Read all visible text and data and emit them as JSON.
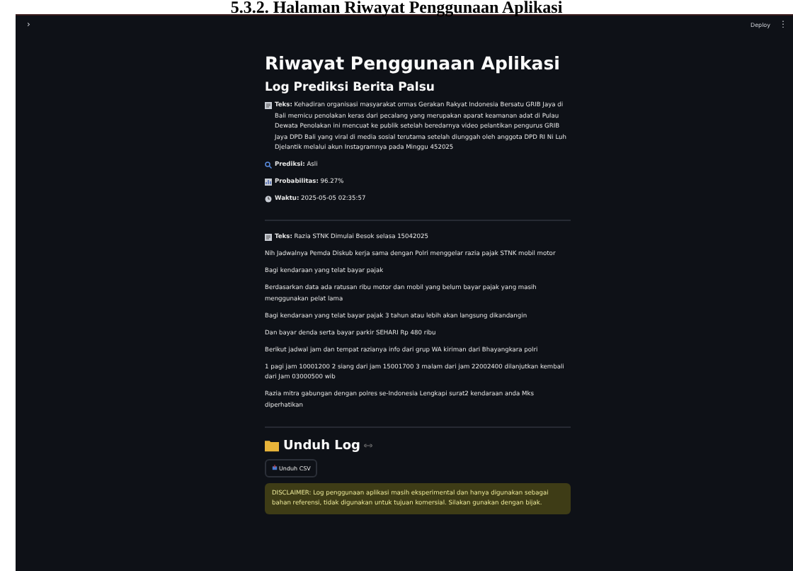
{
  "caption": "5.3.2. Halaman Riwayat Penggunaan Aplikasi",
  "header": {
    "sidebar_toggle": "›",
    "deploy": "Deploy",
    "menu": "⋮"
  },
  "title": "Riwayat Penggunaan Aplikasi",
  "subtitle": "Log Prediksi Berita Palsu",
  "entries": [
    {
      "items": [
        {
          "kind": "text",
          "text": "**Teks:** Kehadiran organisasi masyarakat ormas Gerakan Rakyat Indonesia Bersatu GRIB Jaya di Bali memicu penolakan keras dari pecalang yang merupakan aparat keamanan adat di Pulau Dewata Penolakan ini mencuat ke publik setelah beredarnya video pelantikan pengurus GRIB Jaya DPD Bali yang viral di media sosial terutama setelah diunggah oleh anggota DPD RI Ni Luh Djelantik melalui akun Instagramnya pada Minggu 452025"
        },
        {
          "kind": "prediction",
          "text": "**Prediksi:** Asli"
        },
        {
          "kind": "probability",
          "text": "**Probabilitas:** 96.27%"
        },
        {
          "kind": "time",
          "text": "**Waktu:** 2025-05-05 02:35:57"
        }
      ]
    },
    {
      "items": [
        {
          "kind": "text",
          "text": "**Teks:** Razia STNK Dimulai Besok selasa 15042025"
        },
        {
          "kind": "paragraph",
          "text": "Nih Jadwalnya Pemda Diskub kerja sama dengan Polri menggelar razia pajak STNK mobil motor"
        },
        {
          "kind": "paragraph",
          "text": "Bagi kendaraan yang telat bayar pajak"
        },
        {
          "kind": "paragraph",
          "text": "Berdasarkan data ada ratusan ribu motor dan mobil yang belum bayar pajak yang masih menggunakan pelat lama"
        },
        {
          "kind": "paragraph",
          "text": "Bagi kendaraan yang telat bayar pajak 3 tahun atau lebih akan langsung dikandangin"
        },
        {
          "kind": "paragraph",
          "text": "Dan bayar denda serta bayar parkir SEHARI Rp 480 ribu"
        },
        {
          "kind": "paragraph",
          "text": "Berikut jadwal jam dan tempat razianya info dari grup WA kiriman dari Bhayangkara polri"
        },
        {
          "kind": "paragraph",
          "text": "1 pagi jam 10001200 2 siang dari jam 15001700 3 malam dari jam 22002400 dilanjutkan kembali dari Jam 03000500 wib"
        },
        {
          "kind": "paragraph",
          "text": "Razia mitra gabungan dengan polres se-Indonesia Lengkapi surat2 kendaraan anda Mks diperhatikan"
        }
      ]
    }
  ],
  "download": {
    "heading": "Unduh Log",
    "button": "Unduh CSV"
  },
  "disclaimer": "DISCLAIMER: Log penggunaan aplikasi masih eksperimental dan hanya digunakan sebagai bahan referensi, tidak digunakan untuk tujuan komersial. Silakan gunakan dengan bijak."
}
